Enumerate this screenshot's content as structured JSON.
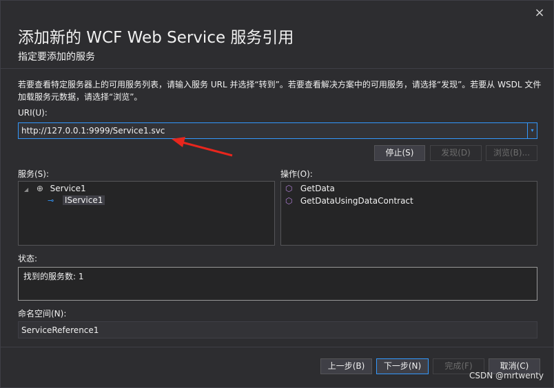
{
  "dialog": {
    "title": "添加新的 WCF Web Service 服务引用",
    "subtitle": "指定要添加的服务",
    "description": "若要查看特定服务器上的可用服务列表，请输入服务 URL 并选择“转到”。若要查看解决方案中的可用服务，请选择“发现”。若要从 WSDL 文件加载服务元数据，请选择“浏览”。",
    "close_icon": "×"
  },
  "uri": {
    "label": "URI(U):",
    "value": "http://127.0.0.1:9999/Service1.svc",
    "dropdown_glyph": "▾"
  },
  "actions": {
    "stop_label": "停止(S)",
    "discover_label": "发现(D)",
    "browse_label": "浏览(B)..."
  },
  "services": {
    "label": "服务(S):",
    "items": [
      {
        "label": "Service1",
        "icon": "service-globe-icon",
        "expanded": true
      },
      {
        "label": "IService1",
        "icon": "interface-icon",
        "selected": true
      }
    ]
  },
  "operations": {
    "label": "操作(O):",
    "items": [
      {
        "label": "GetData",
        "icon": "method-cube-icon"
      },
      {
        "label": "GetDataUsingDataContract",
        "icon": "method-cube-icon"
      }
    ]
  },
  "status": {
    "label": "状态:",
    "text": "找到的服务数: 1"
  },
  "namespace": {
    "label": "命名空间(N):",
    "value": "ServiceReference1"
  },
  "footer": {
    "prev_label": "上一步(B)",
    "next_label": "下一步(N)",
    "finish_label": "完成(F)",
    "cancel_label": "取消(C)"
  },
  "watermark": "CSDN @mrtwenty",
  "colors": {
    "background": "#2d2d30",
    "accent": "#3399ff",
    "annotation_arrow": "#e8261d",
    "method_icon": "#b180d7"
  }
}
